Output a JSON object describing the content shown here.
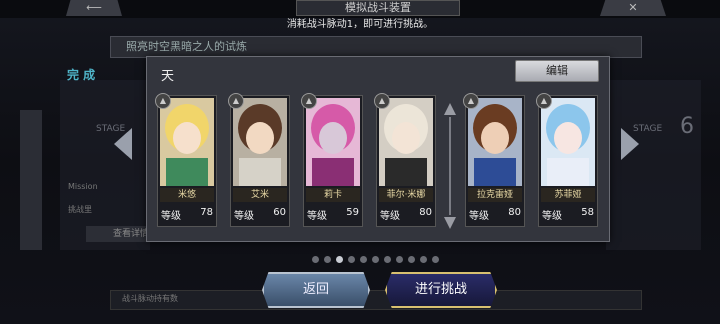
{
  "header": {
    "title": "模拟战斗装置",
    "subtitle": "消耗战斗脉动1，即可进行挑战。",
    "banner": "照亮时空黑暗之人的试炼"
  },
  "background": {
    "complete_label": "完 成",
    "stage_left": "STAGE",
    "stage_right": "STAGE",
    "stage_number_right": "6",
    "faded_row1": "Mission",
    "faded_row2": "挑战里",
    "faded_button": "查看详情",
    "bottom_text": "战斗脉动持有数"
  },
  "modal": {
    "team_name": "天",
    "edit_label": "编辑",
    "level_label": "等级",
    "characters": [
      {
        "name": "米悠",
        "level": "78",
        "hair": "#f1d56a",
        "outfit": "#3f8a5c"
      },
      {
        "name": "艾米",
        "level": "60",
        "hair": "#5a3a28",
        "outfit": "#d6d2c8"
      },
      {
        "name": "莉卡",
        "level": "59",
        "hair": "#d65aa8",
        "outfit": "#8a2f74"
      },
      {
        "name": "菲尔·米娜",
        "level": "80",
        "hair": "#ece5d8",
        "outfit": "#2a2a2a"
      },
      {
        "name": "拉克雷娅",
        "level": "80",
        "hair": "#6a3c22",
        "outfit": "#2d4c96"
      },
      {
        "name": "苏菲娅",
        "level": "58",
        "hair": "#8cc6ec",
        "outfit": "#e9eef8"
      }
    ]
  },
  "pagination": {
    "count": 11,
    "active": 2
  },
  "buttons": {
    "back": "返回",
    "challenge": "进行挑战"
  }
}
